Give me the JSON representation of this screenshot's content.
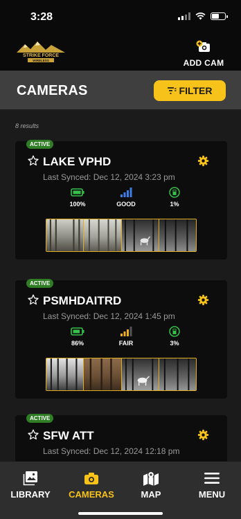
{
  "status_bar": {
    "time": "3:28"
  },
  "header": {
    "logo_text_top": "STRIKE FORCE",
    "logo_text_bottom": "WIRELESS",
    "add_cam_label": "ADD CAM"
  },
  "page": {
    "title": "CAMERAS",
    "filter_label": "FILTER",
    "results_text": "8 results"
  },
  "cameras": [
    {
      "status": "ACTIVE",
      "name": "LAKE VPHD",
      "last_synced": "Last Synced: Dec 12, 2024 3:23 pm",
      "battery": "100%",
      "signal": "GOOD",
      "storage": "1%",
      "signal_color": "#3a7ee8"
    },
    {
      "status": "ACTIVE",
      "name": "PSMHDAITRD",
      "last_synced": "Last Synced: Dec 12, 2024 1:45 pm",
      "battery": "86%",
      "signal": "FAIR",
      "storage": "3%",
      "signal_color": "#f0b21a"
    },
    {
      "status": "ACTIVE",
      "name": "SFW ATT",
      "last_synced": "Last Synced: Dec 12, 2024 12:18 pm"
    }
  ],
  "tabs": [
    {
      "label": "LIBRARY",
      "icon": "image-icon"
    },
    {
      "label": "CAMERAS",
      "icon": "camera-icon",
      "active": true
    },
    {
      "label": "MAP",
      "icon": "map-icon"
    },
    {
      "label": "MENU",
      "icon": "menu-icon"
    }
  ],
  "colors": {
    "accent": "#f7c21a",
    "active_badge": "#2f7d24",
    "battery_green": "#36c24a"
  }
}
